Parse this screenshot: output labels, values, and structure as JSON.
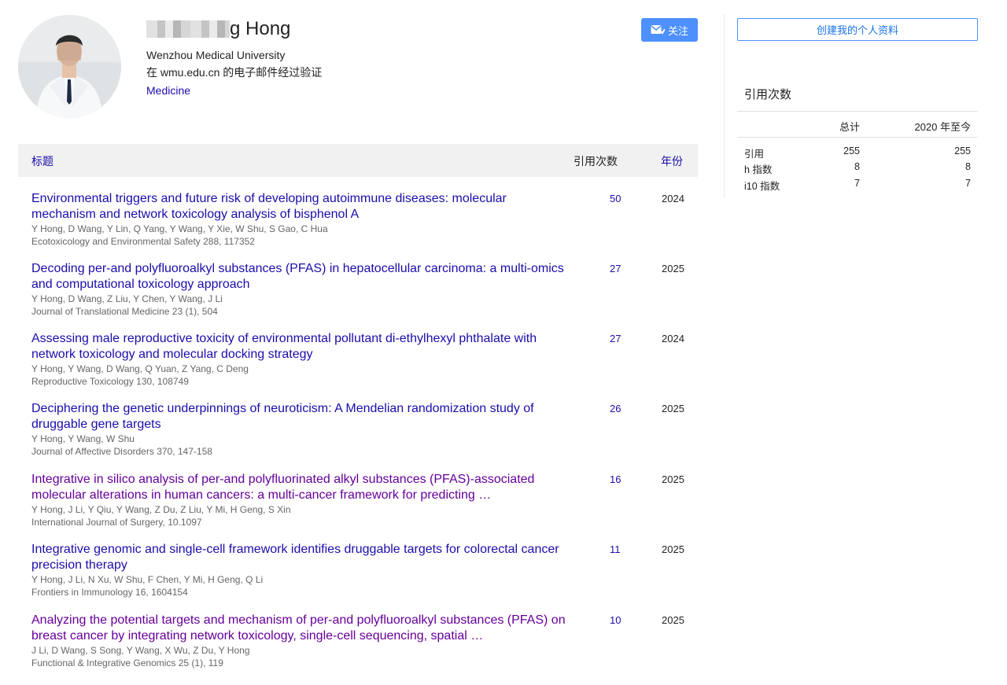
{
  "profile": {
    "name_suffix": "g Hong",
    "affiliation": "Wenzhou Medical University",
    "email_verify": "在 wmu.edu.cn 的电子邮件经过验证",
    "interest": "Medicine",
    "follow_label": "关注"
  },
  "table": {
    "col_title": "标题",
    "col_cited_by": "引用次数",
    "col_year": "年份"
  },
  "publications": [
    {
      "title": "Environmental triggers and future risk of developing autoimmune diseases: molecular mechanism and network toxicology analysis of bisphenol A",
      "authors": "Y Hong, D Wang, Y Lin, Q Yang, Y Wang, Y Xie, W Shu, S Gao, C Hua",
      "venue": "Ecotoxicology and Environmental Safety 288, 117352",
      "cited_by": "50",
      "year": "2024",
      "visited": false
    },
    {
      "title": "Decoding per-and polyfluoroalkyl substances (PFAS) in hepatocellular carcinoma: a multi-omics and computational toxicology approach",
      "authors": "Y Hong, D Wang, Z Liu, Y Chen, Y Wang, J Li",
      "venue": "Journal of Translational Medicine 23 (1), 504",
      "cited_by": "27",
      "year": "2025",
      "visited": false
    },
    {
      "title": "Assessing male reproductive toxicity of environmental pollutant di-ethylhexyl phthalate with network toxicology and molecular docking strategy",
      "authors": "Y Hong, Y Wang, D Wang, Q Yuan, Z Yang, C Deng",
      "venue": "Reproductive Toxicology 130, 108749",
      "cited_by": "27",
      "year": "2024",
      "visited": false
    },
    {
      "title": "Deciphering the genetic underpinnings of neuroticism: A Mendelian randomization study of druggable gene targets",
      "authors": "Y Hong, Y Wang, W Shu",
      "venue": "Journal of Affective Disorders 370, 147-158",
      "cited_by": "26",
      "year": "2025",
      "visited": false
    },
    {
      "title": "Integrative in silico analysis of per-and polyfluorinated alkyl substances (PFAS)-associated molecular alterations in human cancers: a multi-cancer framework for predicting …",
      "authors": "Y Hong, J Li, Y Qiu, Y Wang, Z Du, Z Liu, Y Mi, H Geng, S Xin",
      "venue": "International Journal of Surgery, 10.1097",
      "cited_by": "16",
      "year": "2025",
      "visited": true
    },
    {
      "title": "Integrative genomic and single-cell framework identifies druggable targets for colorectal cancer precision therapy",
      "authors": "Y Hong, J Li, N Xu, W Shu, F Chen, Y Mi, H Geng, Q Li",
      "venue": "Frontiers in Immunology 16, 1604154",
      "cited_by": "11",
      "year": "2025",
      "visited": false
    },
    {
      "title": "Analyzing the potential targets and mechanism of per-and polyfluoroalkyl substances (PFAS) on breast cancer by integrating network toxicology, single-cell sequencing, spatial …",
      "authors": "J Li, D Wang, S Song, Y Wang, X Wu, Z Du, Y Hong",
      "venue": "Functional & Integrative Genomics 25 (1), 119",
      "cited_by": "10",
      "year": "2025",
      "visited": true
    }
  ],
  "sidebar": {
    "create_profile_label": "创建我的个人资料",
    "cited_by_heading": "引用次数",
    "col_all": "总计",
    "col_since": "2020 年至今",
    "rows": [
      {
        "label": "引用",
        "all": "255",
        "since": "255"
      },
      {
        "label": "h 指数",
        "all": "8",
        "since": "8"
      },
      {
        "label": "i10 指数",
        "all": "7",
        "since": "7"
      }
    ]
  },
  "colors": {
    "link": "#1a0dab",
    "visited": "#660099",
    "accent": "#4d90fe"
  }
}
